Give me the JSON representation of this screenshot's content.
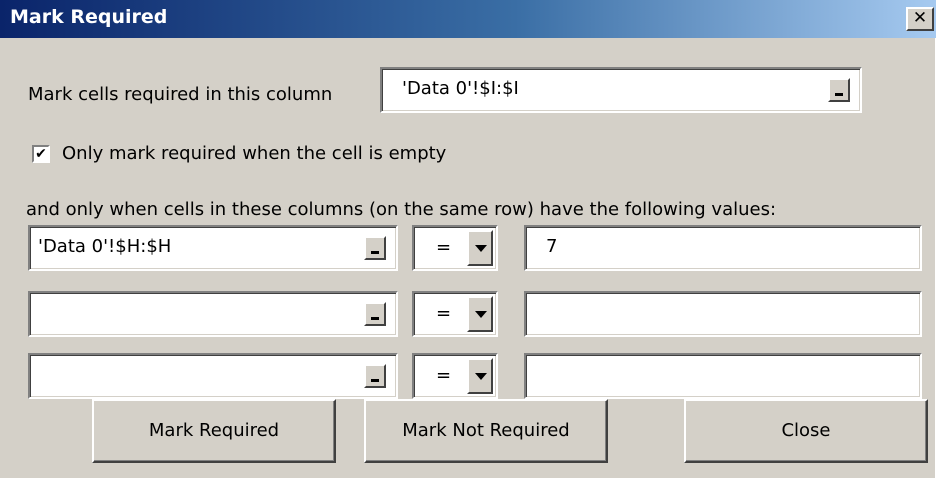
{
  "window": {
    "title": "Mark Required",
    "close_glyph": "✕"
  },
  "column": {
    "label": "Mark cells required in this column",
    "value": "'Data 0'!$I:$I"
  },
  "only_empty": {
    "checked": true,
    "check_glyph": "✔",
    "label": "Only mark required when the cell is empty"
  },
  "conditions": {
    "intro": "and only when cells in these columns (on the same row) have the following values:",
    "rows": [
      {
        "range": "'Data 0'!$H:$H",
        "operator": "=",
        "value": "7"
      },
      {
        "range": "",
        "operator": "=",
        "value": ""
      },
      {
        "range": "",
        "operator": "=",
        "value": ""
      }
    ]
  },
  "buttons": {
    "mark_required": "Mark Required",
    "mark_not_required": "Mark Not Required",
    "close": "Close"
  },
  "icons": {
    "ref_button": "collapse-dialog-icon",
    "dropdown": "chevron-down-icon"
  }
}
